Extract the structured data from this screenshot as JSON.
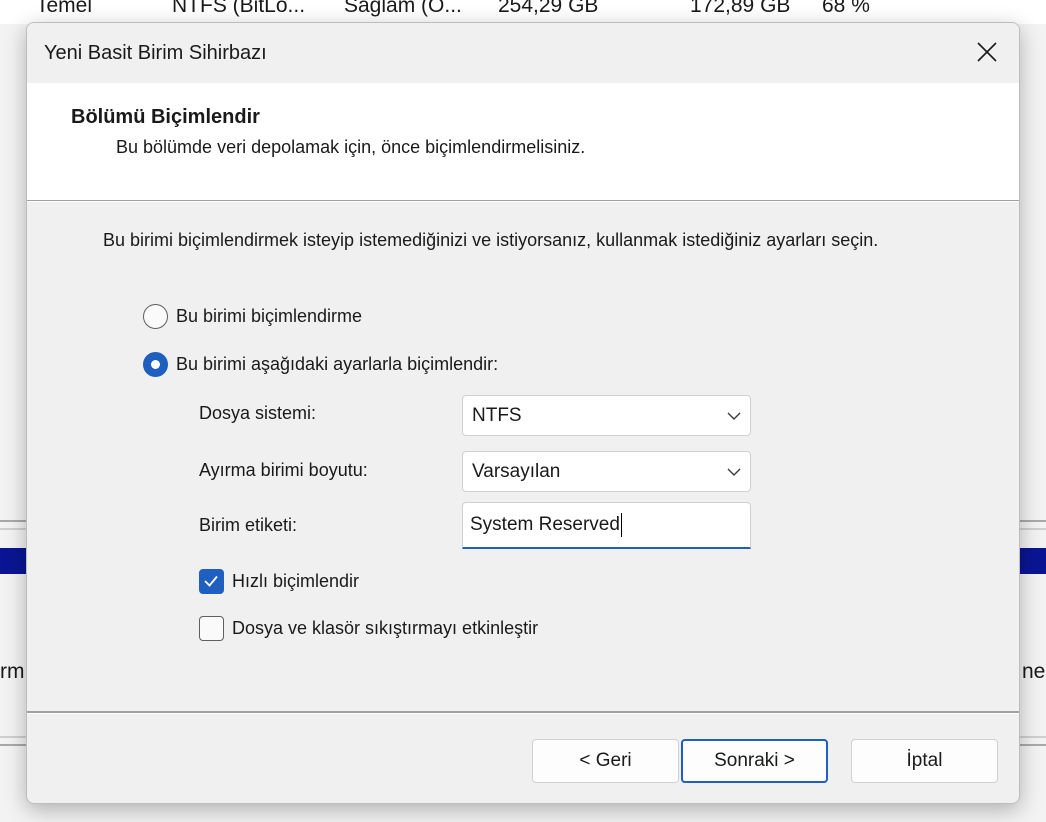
{
  "background": {
    "row": {
      "layout": "Temel",
      "filesystem": "NTFS (BitLo...",
      "status": "Sağlam (O...",
      "capacity": "254,29 GB",
      "free": "172,89 GB",
      "percent_free": "68 %"
    },
    "left_fragment": "rm",
    "right_fragment": "ne"
  },
  "dialog": {
    "title": "Yeni Basit Birim Sihirbazı",
    "header": {
      "title": "Bölümü Biçimlendir",
      "subtitle": "Bu bölümde veri depolamak için, önce biçimlendirmelisiniz."
    },
    "instruction": "Bu birimi biçimlendirmek isteyip istemediğinizi ve istiyorsanız, kullanmak istediğiniz ayarları seçin.",
    "options": {
      "no_format": {
        "label": "Bu birimi biçimlendirme",
        "selected": false
      },
      "format": {
        "label": "Bu birimi aşağıdaki ayarlarla biçimlendir:",
        "selected": true
      }
    },
    "fields": {
      "filesystem": {
        "label": "Dosya sistemi:",
        "value": "NTFS"
      },
      "allocation": {
        "label": "Ayırma birimi boyutu:",
        "value": "Varsayılan"
      },
      "volume_label": {
        "label": "Birim etiketi:",
        "value": "System Reserved"
      }
    },
    "checkboxes": {
      "quick_format": {
        "label": "Hızlı biçimlendir",
        "checked": true
      },
      "compression": {
        "label": "Dosya ve klasör sıkıştırmayı etkinleştir",
        "checked": false
      }
    },
    "buttons": {
      "back": "< Geri",
      "next": "Sonraki >",
      "cancel": "İptal"
    }
  },
  "colors": {
    "accent": "#1f5fbf",
    "background_band": "#0a1593"
  },
  "icons": {
    "close": "close-icon",
    "dropdown": "chevron-down-icon",
    "check": "checkmark-icon"
  }
}
